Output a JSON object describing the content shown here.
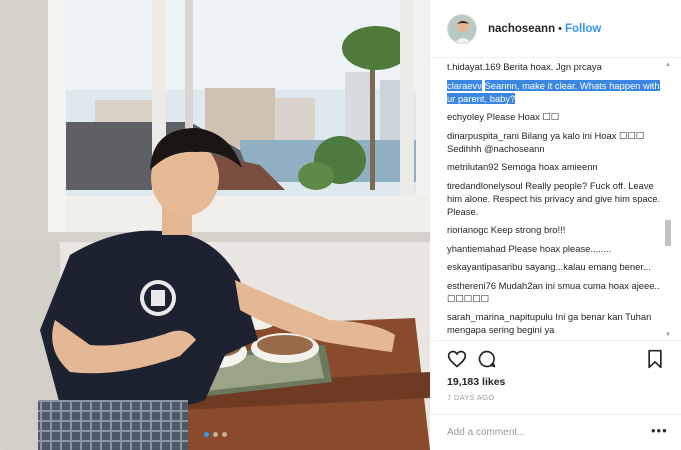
{
  "post": {
    "username": "nachoseann",
    "separator": "•",
    "follow_label": "Follow",
    "carousel_index": 1,
    "carousel_count": 3
  },
  "comments": [
    {
      "user": "t.hidayat.169",
      "text": "Berita hoax. Jgn prcaya"
    },
    {
      "user": "claraevv",
      "text": "Seannn, make it clear. Whats happen with ur parent, baby?",
      "selected": true
    },
    {
      "user": "echyoley",
      "text": "Please Hoax ☐☐"
    },
    {
      "user": "dinarpuspita_rani",
      "text": "Bilang ya kalo ini Hoax ☐☐☐ Sedihhh @nachoseann"
    },
    {
      "user": "metrilutan92",
      "text": "Semoga hoax amieenn"
    },
    {
      "user": "tiredandlonelysoul",
      "text": "Really people? Fuck off. Leave him alone. Respect his privacy and give him space. Please."
    },
    {
      "user": "riorianogc",
      "text": "Keep strong bro!!!"
    },
    {
      "user": "yhantiemahad",
      "text": "Please hoax please........"
    },
    {
      "user": "eskayantipasaribu",
      "text": "sayang...kalau emang bener..."
    },
    {
      "user": "esthereni76",
      "text": "Mudah2an ini smua cuma hoax ajeee.. ☐☐☐☐☐"
    },
    {
      "user": "sarah_marina_napitupulu",
      "text": "Ini ga benar kan Tuhan mengapa sering begini ya"
    }
  ],
  "actions": {
    "like_icon": "heart-icon",
    "comment_icon": "comment-icon",
    "save_icon": "bookmark-icon"
  },
  "likes": "19,183 likes",
  "timestamp": "7 DAYS AGO",
  "add_comment": {
    "placeholder": "Add a comment...",
    "more_label": "•••"
  },
  "colors": {
    "accent": "#3897f0",
    "selection": "#3a86e0",
    "shirt": "#1c2230",
    "table": "#8a4a2c"
  }
}
